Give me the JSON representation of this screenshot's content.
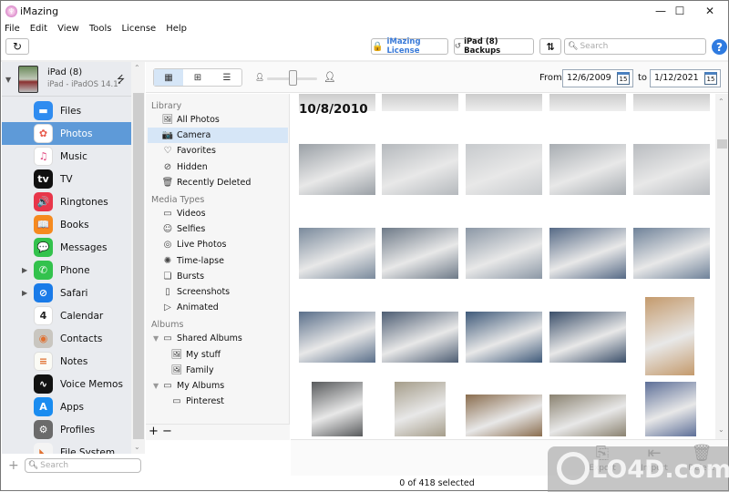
{
  "window": {
    "title": "iMazing",
    "controls": {
      "minimize": "—",
      "maximize": "☐",
      "close": "✕"
    }
  },
  "menu": [
    "File",
    "Edit",
    "View",
    "Tools",
    "License",
    "Help"
  ],
  "toolbar": {
    "refresh_icon": "↻",
    "license_label": "iMazing License",
    "backups_label": "iPad (8) Backups",
    "transfer_icon": "⇅",
    "search_placeholder": "Search",
    "help_label": "?"
  },
  "device": {
    "name": "iPad (8)",
    "subtitle": "iPad - iPadOS 14.1",
    "connection_icon": "usb-icon"
  },
  "apps": [
    {
      "label": "Files",
      "icon": "folder-icon",
      "color": "#2f8cf0",
      "glyph": "▬",
      "expand": false,
      "selected": false
    },
    {
      "label": "Photos",
      "icon": "photos-icon",
      "color": "#ffffff",
      "glyph": "✿",
      "expand": false,
      "selected": true
    },
    {
      "label": "Music",
      "icon": "music-icon",
      "color": "#ffffff",
      "glyph": "♫",
      "expand": false,
      "selected": false
    },
    {
      "label": "TV",
      "icon": "tv-icon",
      "color": "#111111",
      "glyph": "tv",
      "expand": false,
      "selected": false
    },
    {
      "label": "Ringtones",
      "icon": "ringtones-icon",
      "color": "#e8364a",
      "glyph": "🔊",
      "expand": false,
      "selected": false
    },
    {
      "label": "Books",
      "icon": "books-icon",
      "color": "#f58a1f",
      "glyph": "📖",
      "expand": false,
      "selected": false
    },
    {
      "label": "Messages",
      "icon": "messages-icon",
      "color": "#33c24d",
      "glyph": "💬",
      "expand": false,
      "selected": false
    },
    {
      "label": "Phone",
      "icon": "phone-icon",
      "color": "#33c24d",
      "glyph": "✆",
      "expand": true,
      "selected": false
    },
    {
      "label": "Safari",
      "icon": "safari-icon",
      "color": "#1a7be8",
      "glyph": "⊘",
      "expand": true,
      "selected": false
    },
    {
      "label": "Calendar",
      "icon": "calendar-icon",
      "color": "#ffffff",
      "glyph": "4",
      "expand": false,
      "selected": false
    },
    {
      "label": "Contacts",
      "icon": "contacts-icon",
      "color": "#c9c6c0",
      "glyph": "◉",
      "expand": false,
      "selected": false
    },
    {
      "label": "Notes",
      "icon": "notes-icon",
      "color": "#fbfbf5",
      "glyph": "≡",
      "expand": false,
      "selected": false
    },
    {
      "label": "Voice Memos",
      "icon": "voice-memos-icon",
      "color": "#111111",
      "glyph": "∿",
      "expand": false,
      "selected": false
    },
    {
      "label": "Apps",
      "icon": "app-store-icon",
      "color": "#1a8cf0",
      "glyph": "A",
      "expand": false,
      "selected": false
    },
    {
      "label": "Profiles",
      "icon": "profiles-icon",
      "color": "#6b6b6b",
      "glyph": "⚙",
      "expand": false,
      "selected": false
    },
    {
      "label": "File System",
      "icon": "file-system-icon",
      "color": "#f4f4f4",
      "glyph": "◣",
      "expand": false,
      "selected": false
    }
  ],
  "sidebar_footer": {
    "add_icon": "+",
    "search_placeholder": "Search"
  },
  "view_controls": {
    "modes": [
      {
        "name": "small-grid",
        "glyph": "▦",
        "active": true
      },
      {
        "name": "large-grid",
        "glyph": "⊞",
        "active": false
      },
      {
        "name": "list",
        "glyph": "☰",
        "active": false
      }
    ],
    "thumbnail_size_fraction": 0.5
  },
  "date_filter": {
    "from_label": "From",
    "from_value": "12/6/2009",
    "to_label": "to",
    "to_value": "1/12/2021",
    "calendar_glyph": "15"
  },
  "library": {
    "sections": [
      {
        "title": "Library",
        "items": [
          {
            "label": "All Photos",
            "icon": "all-photos-icon",
            "glyph": "🖼",
            "selected": false,
            "indent": 0
          },
          {
            "label": "Camera",
            "icon": "camera-icon",
            "glyph": "📷",
            "selected": true,
            "indent": 0
          },
          {
            "label": "Favorites",
            "icon": "heart-icon",
            "glyph": "♡",
            "selected": false,
            "indent": 0
          },
          {
            "label": "Hidden",
            "icon": "hidden-icon",
            "glyph": "⊘",
            "selected": false,
            "indent": 0
          },
          {
            "label": "Recently Deleted",
            "icon": "trash-icon",
            "glyph": "🗑",
            "selected": false,
            "indent": 0
          }
        ]
      },
      {
        "title": "Media Types",
        "items": [
          {
            "label": "Videos",
            "icon": "video-icon",
            "glyph": "▭",
            "selected": false,
            "indent": 0
          },
          {
            "label": "Selfies",
            "icon": "selfie-icon",
            "glyph": "☺",
            "selected": false,
            "indent": 0
          },
          {
            "label": "Live Photos",
            "icon": "live-photo-icon",
            "glyph": "◎",
            "selected": false,
            "indent": 0
          },
          {
            "label": "Time-lapse",
            "icon": "time-lapse-icon",
            "glyph": "✺",
            "selected": false,
            "indent": 0
          },
          {
            "label": "Bursts",
            "icon": "bursts-icon",
            "glyph": "❏",
            "selected": false,
            "indent": 0
          },
          {
            "label": "Screenshots",
            "icon": "screenshot-icon",
            "glyph": "▯",
            "selected": false,
            "indent": 0
          },
          {
            "label": "Animated",
            "icon": "animated-icon",
            "glyph": "▷",
            "selected": false,
            "indent": 0
          }
        ]
      },
      {
        "title": "Albums",
        "items": [
          {
            "label": "Shared Albums",
            "icon": "folder-icon",
            "glyph": "▭",
            "selected": false,
            "indent": 0,
            "expand": true
          },
          {
            "label": "My stuff",
            "icon": "album-icon",
            "glyph": "🖼",
            "selected": false,
            "indent": 1
          },
          {
            "label": "Family",
            "icon": "album-icon",
            "glyph": "🖼",
            "selected": false,
            "indent": 1
          },
          {
            "label": "My Albums",
            "icon": "folder-icon",
            "glyph": "▭",
            "selected": false,
            "indent": 0,
            "expand": true
          },
          {
            "label": "Pinterest",
            "icon": "album-icon",
            "glyph": "▭",
            "selected": false,
            "indent": 1
          }
        ]
      }
    ],
    "footer": {
      "add": "+",
      "remove": "−"
    }
  },
  "photos": {
    "date_header": "10/8/2010",
    "rows": [
      [
        "#9aa0a6",
        "#b5b9bd",
        "#c7cacd",
        "#a8adb2",
        "#b9bcc0"
      ],
      [
        "#7a8a9c",
        "#6e7a88",
        "#8b97a5",
        "#566a86",
        "#6f8299"
      ],
      [
        "#5a6f8a",
        "#4d5d73",
        "#3f5a7a",
        "#3b4f6a",
        "#c49a6c"
      ],
      [
        "#585a5c",
        "#a59d8a",
        "#8a6d4e",
        "#8a8270",
        "#5d6f98"
      ]
    ]
  },
  "actions": [
    {
      "label": "Export",
      "icon": "export-icon",
      "glyph": "⎘"
    },
    {
      "label": "Import",
      "icon": "import-icon",
      "glyph": "⇤"
    },
    {
      "label": "Delete",
      "icon": "trash-icon",
      "glyph": "🗑"
    }
  ],
  "status": "0 of 418 selected",
  "watermark": "LO4D.com"
}
